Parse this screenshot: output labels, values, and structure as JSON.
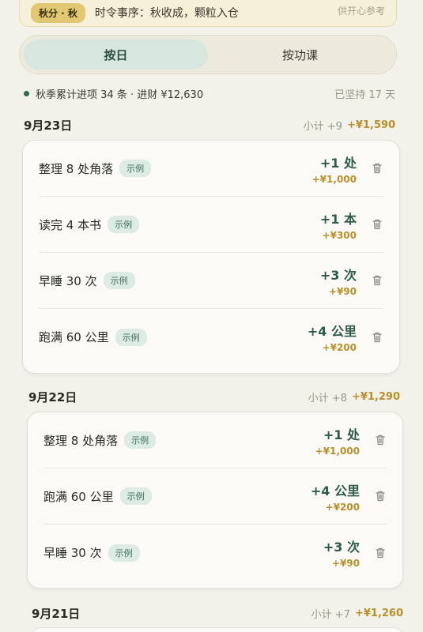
{
  "banner": {
    "badge": "秋分 · 秋",
    "motto": "时令事序：秋收成，颗粒入仓",
    "hint": "供开心参考"
  },
  "tabs": [
    {
      "label": "按日",
      "active": true
    },
    {
      "label": "按功课",
      "active": false
    }
  ],
  "summary": {
    "text": "秋季累计进项 34 条 · 进财 ¥12,630",
    "streak": "已坚持 17 天"
  },
  "days": [
    {
      "date": "9月23日",
      "subtotal": "小计 +9",
      "money": "+¥1,590",
      "items": [
        {
          "name": "整理 8 处角落",
          "tag": "示例",
          "qty": "+1 处",
          "cash": "+¥1,000"
        },
        {
          "name": "读完 4 本书",
          "tag": "示例",
          "qty": "+1 本",
          "cash": "+¥300"
        },
        {
          "name": "早睡 30 次",
          "tag": "示例",
          "qty": "+3 次",
          "cash": "+¥90"
        },
        {
          "name": "跑满 60 公里",
          "tag": "示例",
          "qty": "+4 公里",
          "cash": "+¥200"
        }
      ]
    },
    {
      "date": "9月22日",
      "subtotal": "小计 +8",
      "money": "+¥1,290",
      "items": [
        {
          "name": "整理 8 处角落",
          "tag": "示例",
          "qty": "+1 处",
          "cash": "+¥1,000"
        },
        {
          "name": "跑满 60 公里",
          "tag": "示例",
          "qty": "+4 公里",
          "cash": "+¥200"
        },
        {
          "name": "早睡 30 次",
          "tag": "示例",
          "qty": "+3 次",
          "cash": "+¥90"
        }
      ]
    },
    {
      "date": "9月21日",
      "subtotal": "小计 +7",
      "money": "+¥1,260",
      "items": []
    }
  ],
  "colors": {
    "accent_green": "#2e5a4a",
    "money_gold": "#b8902c",
    "tag_bg": "#dcebe4"
  }
}
